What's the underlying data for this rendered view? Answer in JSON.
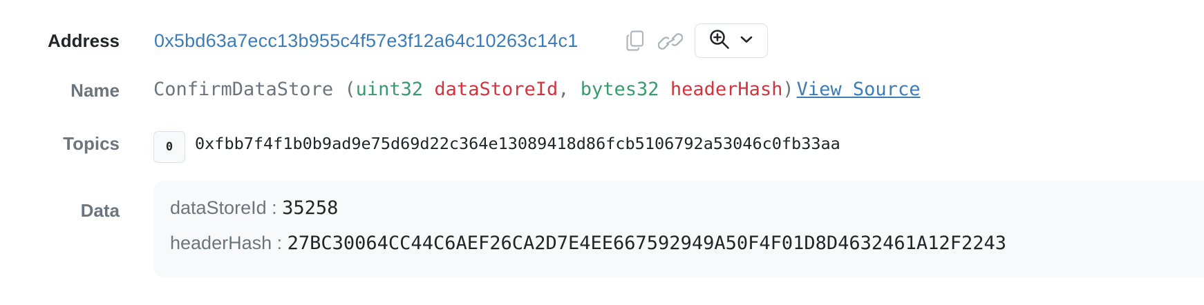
{
  "address": {
    "label": "Address",
    "value": "0x5bd63a7ecc13b955c4f57e3f12a64c10263c14c1"
  },
  "name": {
    "label": "Name",
    "function": "ConfirmDataStore",
    "open_paren": " (",
    "param1_type": "uint32",
    "param1_name": "dataStoreId",
    "comma": ", ",
    "param2_type": "bytes32",
    "param2_name": "headerHash",
    "close_paren": ")",
    "view_source": "View Source"
  },
  "topics": {
    "label": "Topics",
    "items": [
      {
        "index": "0",
        "hash": "0xfbb7f4f1b0b9ad9e75d69d22c364e13089418d86fcb5106792a53046c0fb33aa"
      }
    ]
  },
  "data": {
    "label": "Data",
    "entries": [
      {
        "key": "dataStoreId",
        "value": "35258"
      },
      {
        "key": "headerHash",
        "value": "27BC30064CC44C6AEF26CA2D7E4EE667592949A50F4F01D8D4632461A12F2243"
      }
    ]
  },
  "colors": {
    "link": "#3b7cb8",
    "type": "#3a9a6e",
    "param": "#d0353f",
    "muted": "#6c757d"
  },
  "icons": [
    "copy-icon",
    "link-icon",
    "zoom-in-icon",
    "chevron-down-icon"
  ]
}
